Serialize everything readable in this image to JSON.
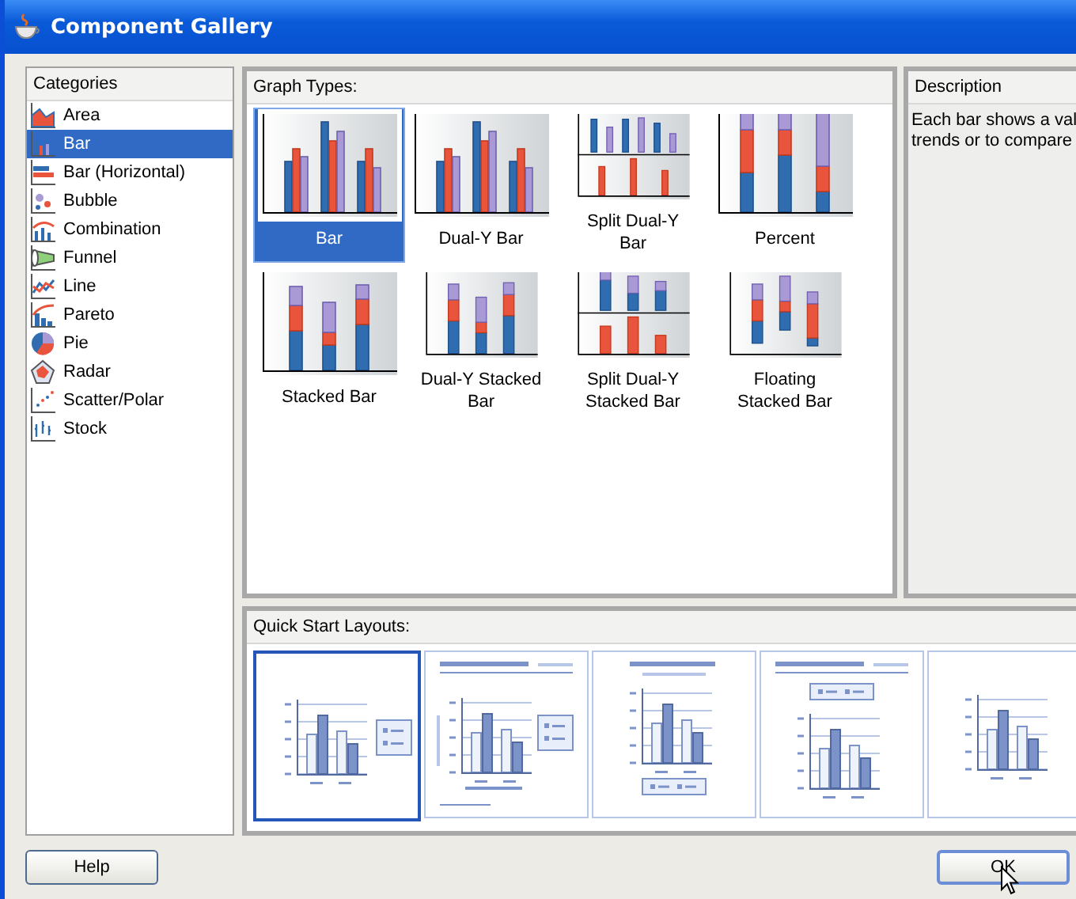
{
  "window": {
    "title": "Component Gallery"
  },
  "categories": {
    "heading": "Categories",
    "items": [
      {
        "label": "Area",
        "kind": "area",
        "selected": false
      },
      {
        "label": "Bar",
        "kind": "bar",
        "selected": true
      },
      {
        "label": "Bar (Horizontal)",
        "kind": "hbar",
        "selected": false
      },
      {
        "label": "Bubble",
        "kind": "bubble",
        "selected": false
      },
      {
        "label": "Combination",
        "kind": "combo",
        "selected": false
      },
      {
        "label": "Funnel",
        "kind": "funnel",
        "selected": false
      },
      {
        "label": "Line",
        "kind": "line",
        "selected": false
      },
      {
        "label": "Pareto",
        "kind": "pareto",
        "selected": false
      },
      {
        "label": "Pie",
        "kind": "pie",
        "selected": false
      },
      {
        "label": "Radar",
        "kind": "radar",
        "selected": false
      },
      {
        "label": "Scatter/Polar",
        "kind": "scatter",
        "selected": false
      },
      {
        "label": "Stock",
        "kind": "stock",
        "selected": false
      }
    ]
  },
  "graph_types": {
    "heading": "Graph Types:",
    "items": [
      {
        "label": "Bar",
        "kind": "bar",
        "selected": true
      },
      {
        "label": "Dual-Y Bar",
        "kind": "bar",
        "selected": false
      },
      {
        "label": "Split Dual-Y Bar",
        "kind": "split",
        "selected": false
      },
      {
        "label": "Percent",
        "kind": "percent",
        "selected": false
      },
      {
        "label": "Stacked Bar",
        "kind": "stacked",
        "selected": false
      },
      {
        "label": "Dual-Y Stacked Bar",
        "kind": "stacked",
        "selected": false
      },
      {
        "label": "Split Dual-Y Stacked Bar",
        "kind": "split-stacked",
        "selected": false
      },
      {
        "label": "Floating Stacked Bar",
        "kind": "floating",
        "selected": false
      }
    ]
  },
  "description": {
    "heading": "Description",
    "lines": [
      "Each bar shows a val",
      "trends or to compare"
    ]
  },
  "quick_start": {
    "heading": "Quick Start Layouts:",
    "items": [
      {
        "kind": "legend-right",
        "selected": true
      },
      {
        "kind": "full",
        "selected": false
      },
      {
        "kind": "legend-bottom",
        "selected": false
      },
      {
        "kind": "legend-top",
        "selected": false
      },
      {
        "kind": "plain",
        "selected": false
      }
    ]
  },
  "buttons": [
    {
      "label": "Help",
      "kind": "help"
    },
    {
      "label": "OK",
      "kind": "ok"
    }
  ]
}
